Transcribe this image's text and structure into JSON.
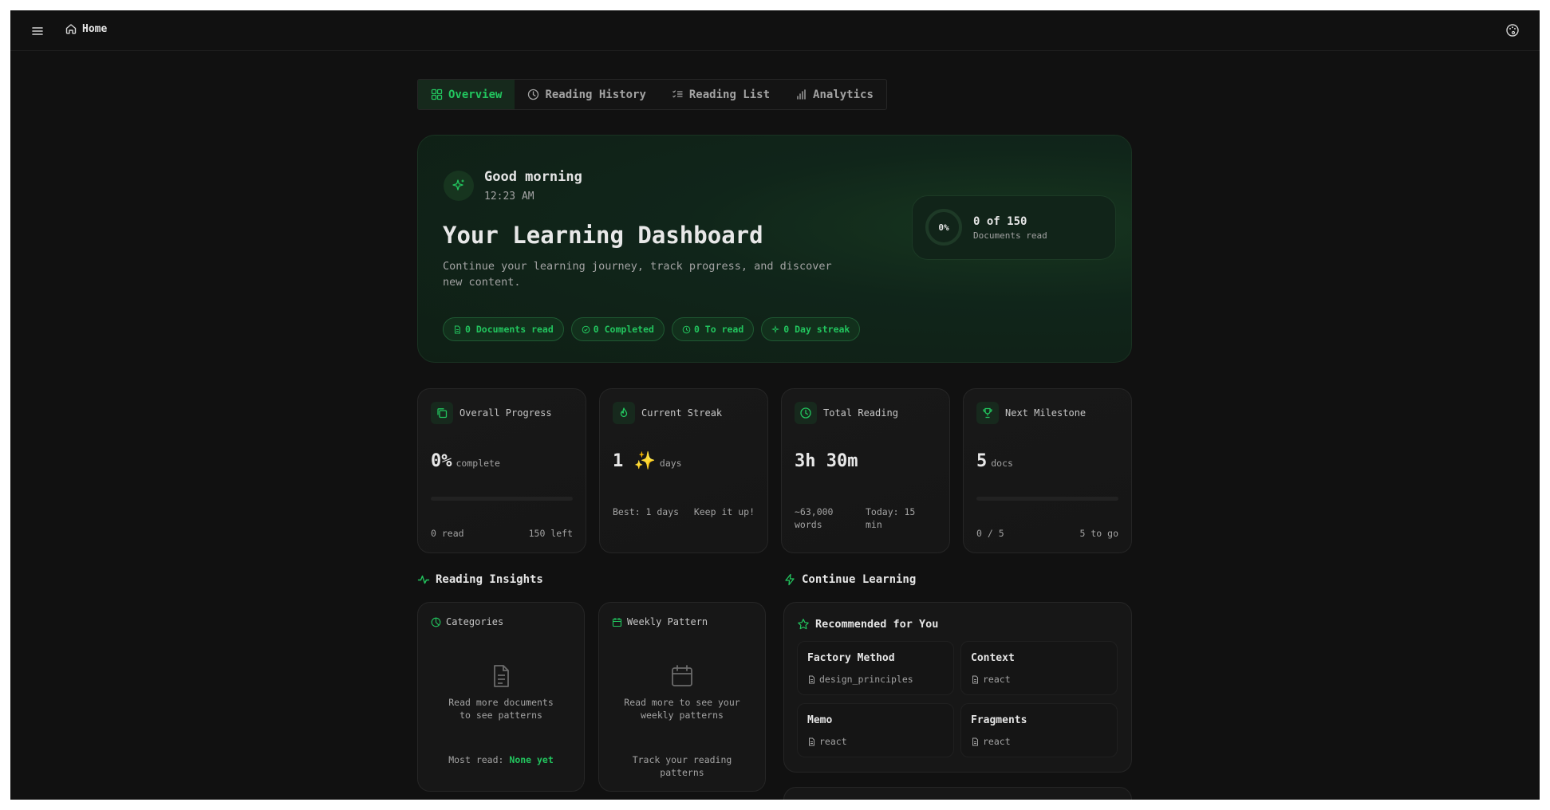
{
  "topbar": {
    "home_label": "Home"
  },
  "tabs": [
    {
      "label": "Overview",
      "active": true
    },
    {
      "label": "Reading History"
    },
    {
      "label": "Reading List"
    },
    {
      "label": "Analytics"
    }
  ],
  "hero": {
    "greeting": "Good morning",
    "time": "12:23 AM",
    "title": "Your Learning Dashboard",
    "subtitle": "Continue your learning journey, track progress, and discover new content.",
    "chips": [
      "0 Documents read",
      "0 Completed",
      "0 To read",
      "0 Day streak"
    ],
    "progress_percent": "0%",
    "progress_count": "0 of 150",
    "progress_label": "Documents read"
  },
  "stats": {
    "overall": {
      "title": "Overall Progress",
      "value": "0%",
      "unit": "complete",
      "fill": 0,
      "left": "0 read",
      "right": "150 left"
    },
    "streak": {
      "title": "Current Streak",
      "value": "1 ✨",
      "unit": "days",
      "best": "Best: 1 days",
      "note": "Keep it up!"
    },
    "total": {
      "title": "Total Reading",
      "value": "3h 30m",
      "words": "~63,000 words",
      "today": "Today: 15 min"
    },
    "milestone": {
      "title": "Next Milestone",
      "value": "5",
      "unit": "docs",
      "fill": 0,
      "left": "0 / 5",
      "right": "5 to go"
    }
  },
  "insights": {
    "title": "Reading Insights",
    "categories": {
      "title": "Categories",
      "message": "Read more documents to see patterns",
      "most_read_label": "Most read:",
      "most_read_value": "None yet"
    },
    "weekly": {
      "title": "Weekly Pattern",
      "message": "Read more to see your weekly patterns",
      "footer": "Track your reading patterns"
    }
  },
  "continue": {
    "title": "Continue Learning",
    "recommended_title": "Recommended for You",
    "items": [
      {
        "title": "Factory Method",
        "category": "design_principles"
      },
      {
        "title": "Context",
        "category": "react"
      },
      {
        "title": "Memo",
        "category": "react"
      },
      {
        "title": "Fragments",
        "category": "react"
      }
    ]
  },
  "colors": {
    "accent": "#22c55e",
    "background": "#111111",
    "card": "#171717"
  }
}
